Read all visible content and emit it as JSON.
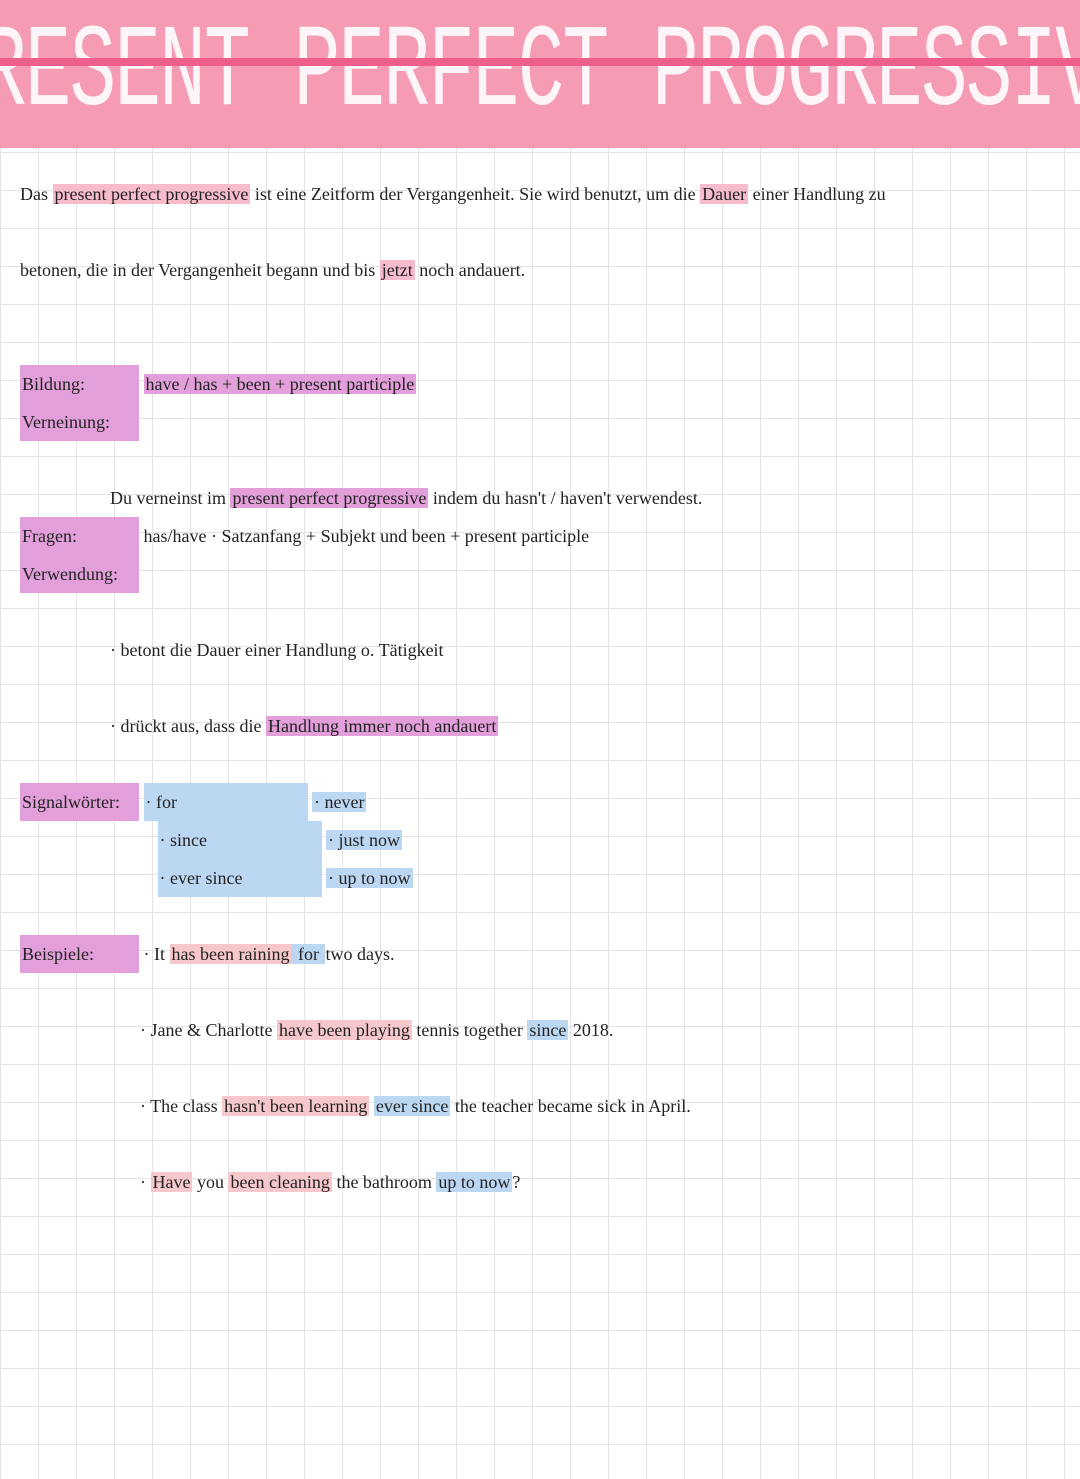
{
  "title": "PRESENT PERFECT PROGRESSIVE",
  "intro": {
    "a": "Das ",
    "b": "present perfect progressive",
    "c": " ist eine Zeitform der Vergangenheit. Sie wird benutzt, um die ",
    "d": "Dauer",
    "e": " einer Handlung zu",
    "f": "betonen, die in der Vergangenheit begann und bis ",
    "g": "jetzt",
    "h": " noch andauert."
  },
  "bildung": {
    "label": "Bildung:",
    "val": "have / has + been + present participle"
  },
  "verneinung": {
    "label": "Verneinung:",
    "a": "Du verneinst im ",
    "b": "present perfect progressive",
    "c": " indem du  hasn't / haven't  verwendest."
  },
  "fragen": {
    "label": "Fragen:",
    "val": "has/have · Satzanfang  +  Subjekt  und  been + present participle"
  },
  "verwendung": {
    "label": "Verwendung:",
    "p1": "· betont die Dauer einer Handlung o. Tätigkeit",
    "p2a": "· drückt aus, dass die ",
    "p2b": "Handlung immer noch andauert"
  },
  "signal": {
    "label": "Signalwörter:",
    "c1": [
      "· for",
      "· since",
      "· ever since"
    ],
    "c2": [
      "· never",
      "· just now",
      "· up to now"
    ]
  },
  "beispiele": {
    "label": "Beispiele:",
    "e1": {
      "a": "· It ",
      "b": "has been raining",
      "c": " for ",
      "d": "two days."
    },
    "e2": {
      "a": "· Jane & Charlotte ",
      "b": "have been playing",
      "c": " tennis together ",
      "d": "since",
      "e": " 2018."
    },
    "e3": {
      "a": "· The class ",
      "b": "hasn't been learning",
      "c": " ",
      "d": "ever since",
      "e": " the teacher became sick in April."
    },
    "e4": {
      "a": "· ",
      "b": "Have",
      "c": " you ",
      "d": "been cleaning",
      "e": " the bathroom ",
      "f": "up to now",
      "g": "?"
    }
  }
}
